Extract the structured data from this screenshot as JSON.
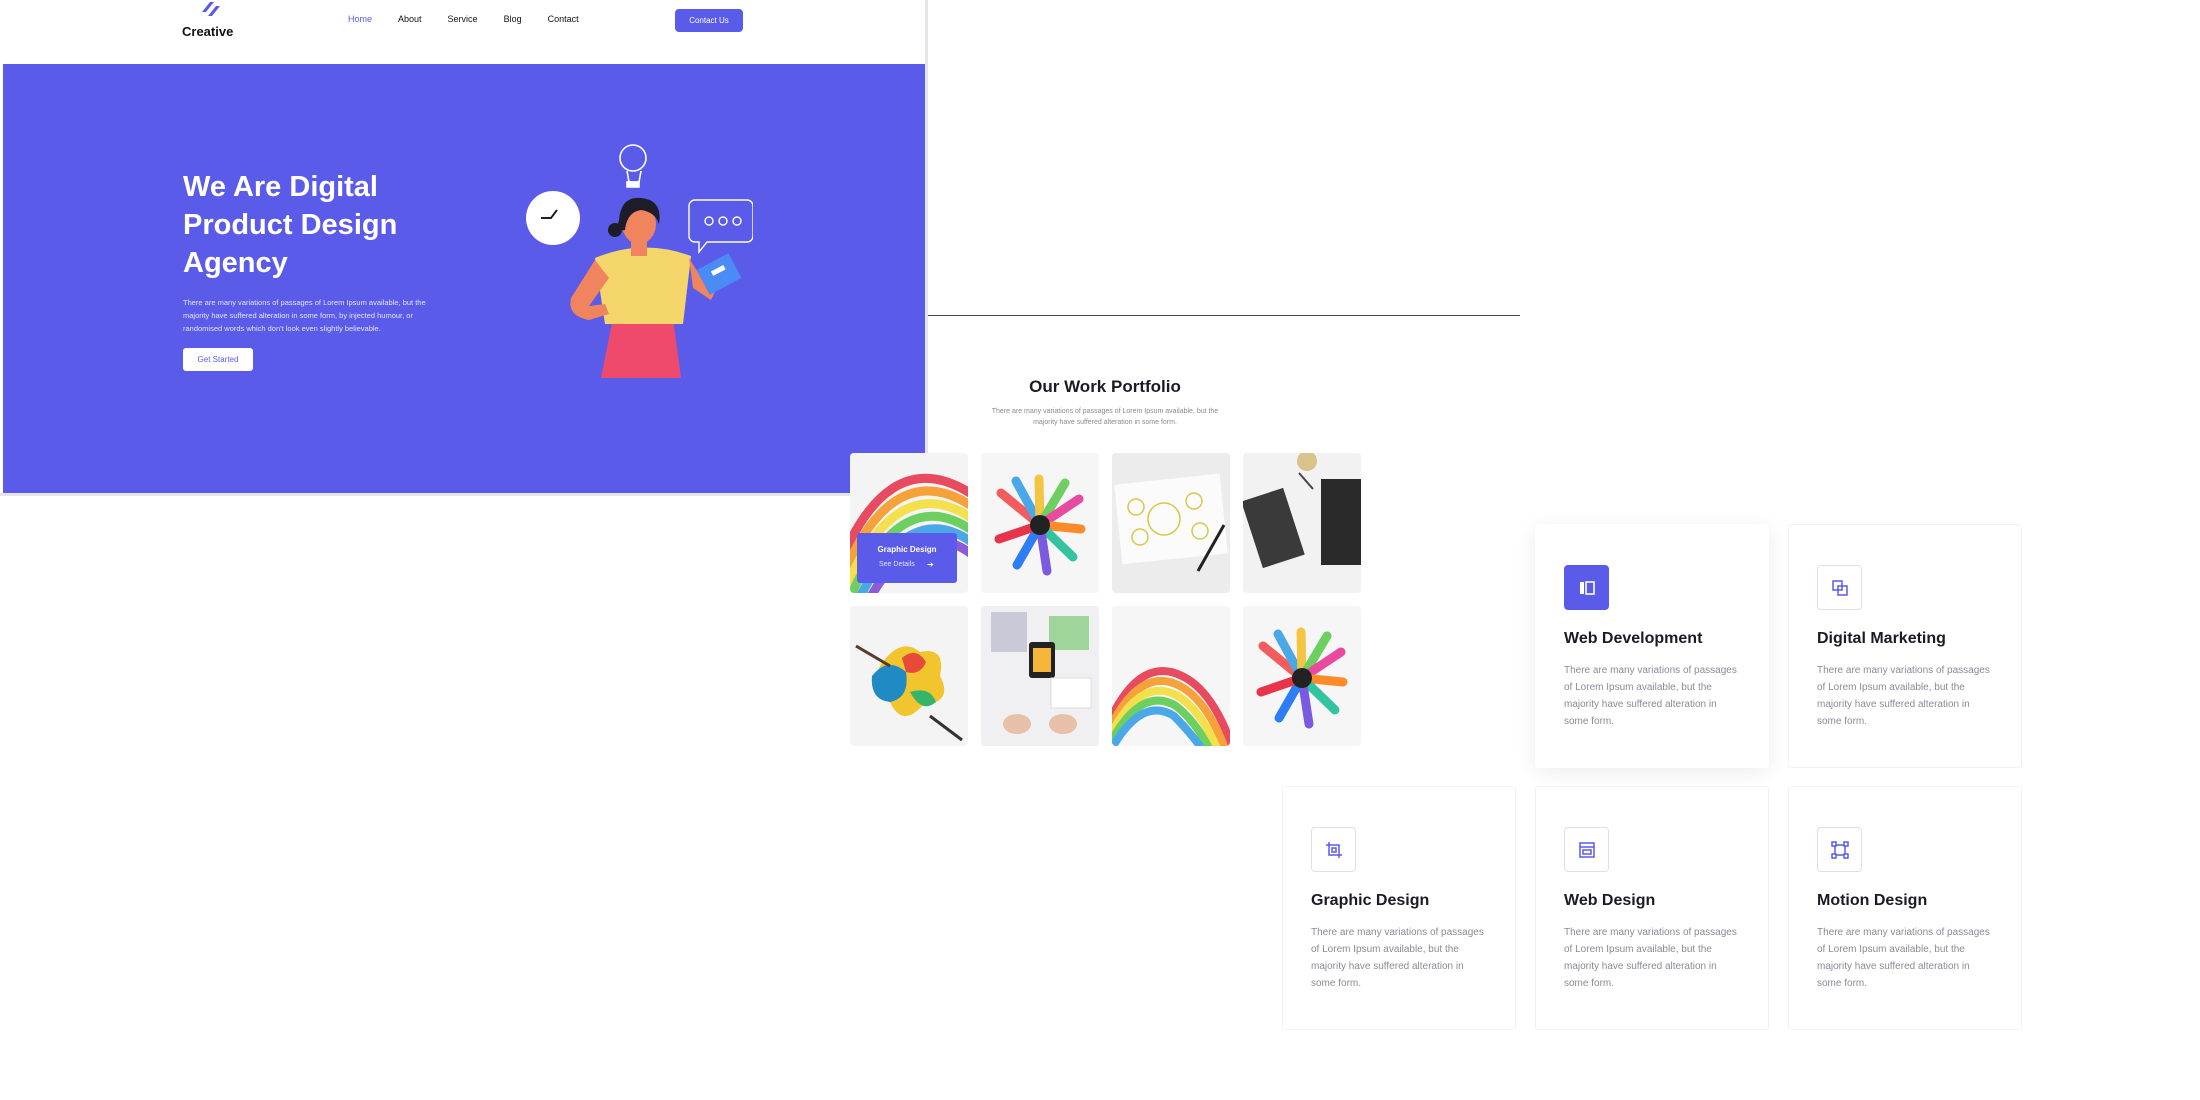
{
  "brand": {
    "name": "Creative"
  },
  "nav": {
    "links": [
      "Home",
      "About",
      "Service",
      "Blog",
      "Contact"
    ],
    "contact_button": "Contact Us"
  },
  "hero": {
    "title": "We Are Digital Product Design Agency",
    "text": "There are many variations of passages of Lorem Ipsum available, but the majority have suffered alteration in some form, by injected humour, or randomised words which don't look even slightly believable.",
    "cta": "Get Started"
  },
  "portfolio": {
    "title": "Our Work Portfolio",
    "subtitle": "There are many variations of passages of Lorem Ipsum available, but the majority have suffered alteration in some form.",
    "overlay": {
      "title": "Graphic Design",
      "link": "See Details"
    }
  },
  "services": [
    {
      "title": "Web Development",
      "text": "There are many variations of passages of Lorem Ipsum available, but the majority have suffered alteration in some form."
    },
    {
      "title": "Digital Marketing",
      "text": "There are many variations of passages of Lorem Ipsum available, but the majority have suffered alteration in some form."
    },
    {
      "title": "Graphic Design",
      "text": "There are many variations of passages of Lorem Ipsum available, but the majority have suffered alteration in some form."
    },
    {
      "title": "Web Design",
      "text": "There are many variations of passages of Lorem Ipsum available, but the majority have suffered alteration in some form."
    },
    {
      "title": "Motion Design",
      "text": "There are many variations of passages of Lorem Ipsum available, but the majority have suffered alteration in some form."
    }
  ],
  "colors": {
    "accent": "#5b5bea",
    "heading": "#1b1b28",
    "muted": "#8a8a98"
  }
}
